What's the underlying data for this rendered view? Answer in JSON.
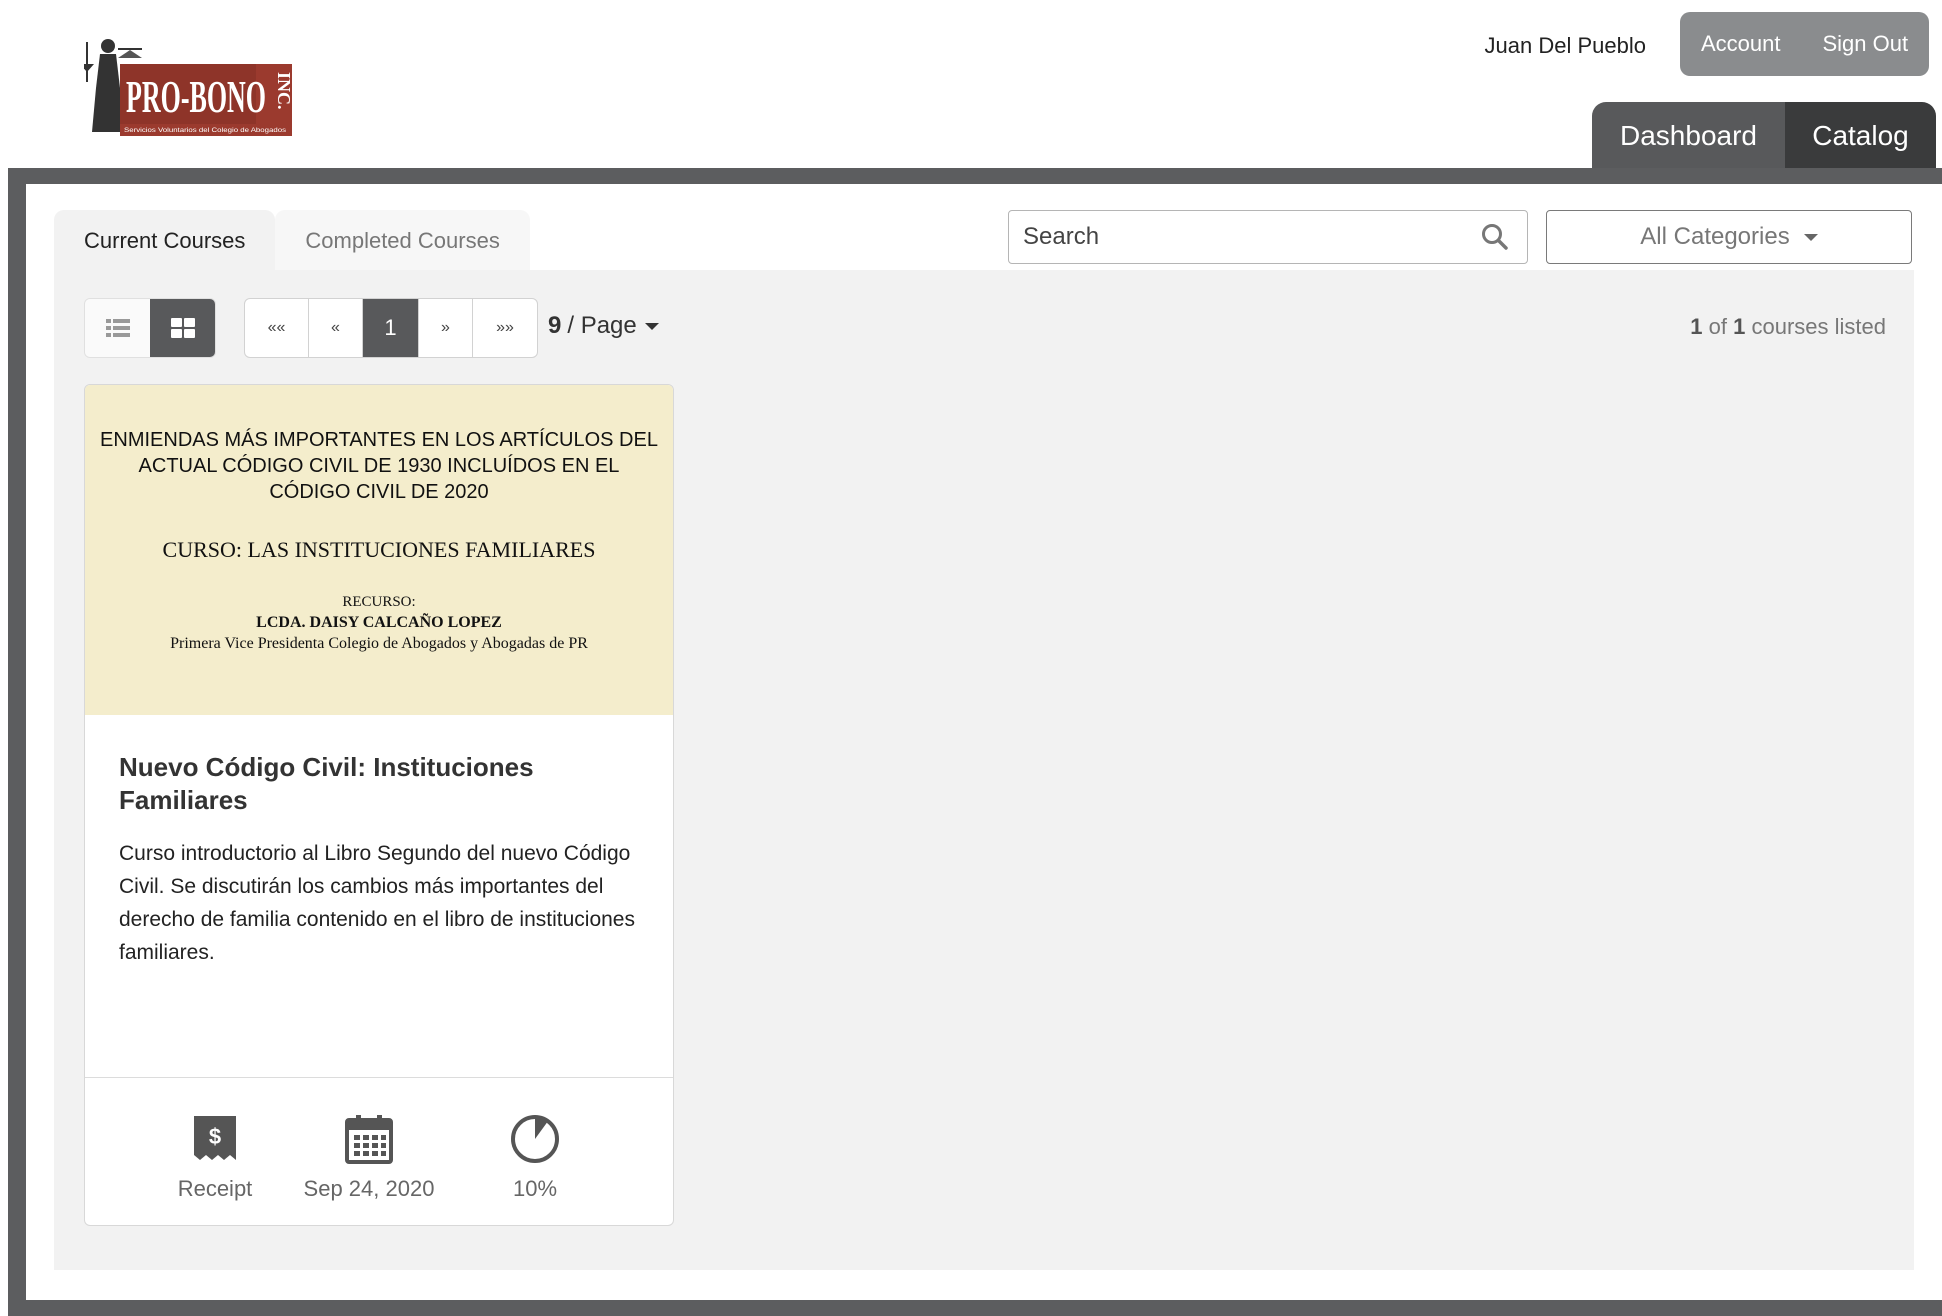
{
  "header": {
    "logo_text": "PRO-BONO",
    "logo_suffix": "INC.",
    "logo_tagline": "Servicios Voluntarios del Colegio de Abogados",
    "user_name": "Juan Del Pueblo",
    "account_label": "Account",
    "signout_label": "Sign Out",
    "nav": {
      "dashboard": "Dashboard",
      "catalog": "Catalog"
    }
  },
  "tabs": {
    "current": "Current Courses",
    "completed": "Completed Courses"
  },
  "search": {
    "placeholder": "Search"
  },
  "category_filter": {
    "selected": "All Categories"
  },
  "pagination": {
    "first": "««",
    "prev": "«",
    "current": "1",
    "next": "»",
    "last": "»»",
    "per_page_count": "9",
    "per_page_label": "/ Page"
  },
  "listing": {
    "shown": "1",
    "of_label": "of",
    "total": "1",
    "suffix": "courses listed"
  },
  "course": {
    "image": {
      "line1": "ENMIENDAS MÁS IMPORTANTES EN LOS ARTÍCULOS DEL ACTUAL CÓDIGO CIVIL DE 1930  INCLUÍDOS EN EL CÓDIGO CIVIL DE 2020",
      "line2": "CURSO:   LAS INSTITUCIONES FAMILIARES",
      "line3": "RECURSO:",
      "line4": "LCDA. DAISY CALCAÑO LOPEZ",
      "line5": "Primera Vice Presidenta Colegio de Abogados y Abogadas de PR"
    },
    "title": "Nuevo Código Civil: Instituciones Familiares",
    "description": "Curso introductorio al Libro Segundo del nuevo Código Civil. Se discutirán los cambios más importantes del derecho de familia contenido en el libro de instituciones familiares.",
    "receipt_label": "Receipt",
    "date": "Sep 24, 2020",
    "progress_label": "10%",
    "progress_value": 0.1
  },
  "colors": {
    "dark_gray": "#58595b",
    "darker_gray": "#3a3b3c",
    "image_bg": "#f4edcc",
    "logo_red": "#9b3a2e"
  }
}
